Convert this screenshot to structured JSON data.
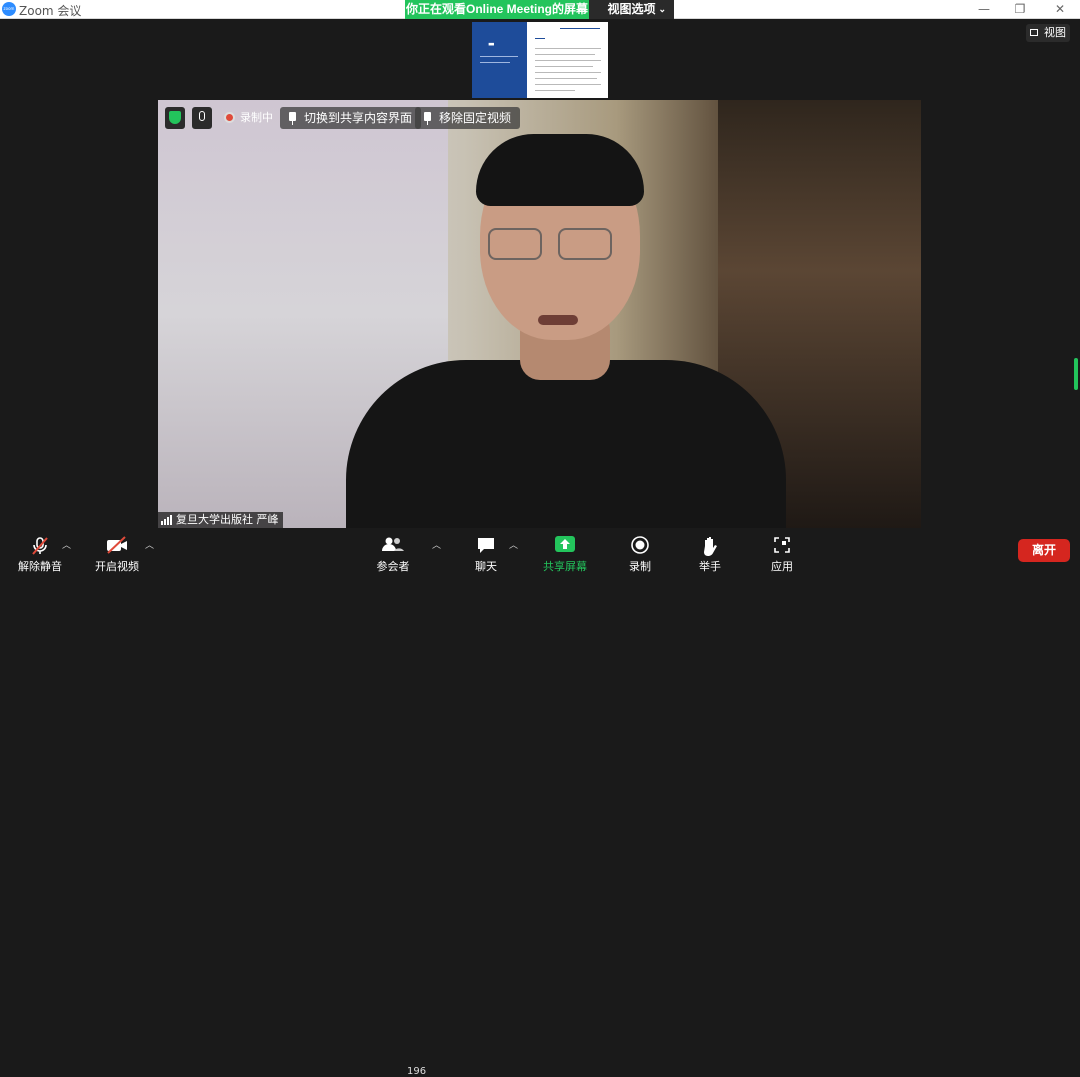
{
  "window": {
    "app_title": "Zoom 会议",
    "logo_text": "zoom"
  },
  "share_banner": {
    "status": "你正在观看Online  Meeting的屏幕",
    "options_label": "视图选项"
  },
  "view_button": "视图",
  "video": {
    "recording_label": "录制中",
    "switch_to_share": "切换到共享内容界面",
    "unpin_video": "移除固定视频",
    "participant_name": "复旦大学出版社 严峰"
  },
  "toolbar": {
    "unmute": "解除静音",
    "start_video": "开启视频",
    "participants": "参会者",
    "participants_count": "196",
    "chat": "聊天",
    "share_screen": "共享屏幕",
    "record": "录制",
    "raise_hand": "举手",
    "apps": "应用",
    "leave": "离开"
  },
  "colors": {
    "accent_green": "#23c45c",
    "leave_red": "#d5261f",
    "zoom_blue": "#2d8cff"
  }
}
